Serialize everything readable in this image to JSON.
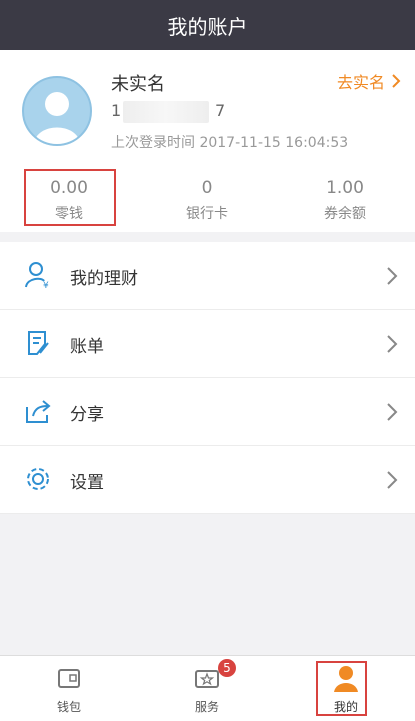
{
  "header": {
    "title": "我的账户"
  },
  "profile": {
    "name": "未实名",
    "verify_label": "去实名",
    "phone_start": "1",
    "phone_end": "7",
    "last_login_label": "上次登录时间",
    "last_login_time": "2017-11-15 16:04:53"
  },
  "stats": [
    {
      "value": "0.00",
      "label": "零钱"
    },
    {
      "value": "0",
      "label": "银行卡"
    },
    {
      "value": "1.00",
      "label": "券余额"
    }
  ],
  "menu": [
    {
      "label": "我的理财",
      "icon": "finance-user-icon"
    },
    {
      "label": "账单",
      "icon": "bill-icon"
    },
    {
      "label": "分享",
      "icon": "share-icon"
    },
    {
      "label": "设置",
      "icon": "gear-icon"
    }
  ],
  "tabbar": [
    {
      "label": "钱包",
      "icon": "wallet-icon"
    },
    {
      "label": "服务",
      "icon": "service-icon",
      "badge": "5"
    },
    {
      "label": "我的",
      "icon": "user-icon",
      "active": true
    }
  ],
  "colors": {
    "accent": "#f08a24",
    "highlight": "#d8433f",
    "icon_blue": "#2e8fd1",
    "topbar": "#3b3a45"
  }
}
